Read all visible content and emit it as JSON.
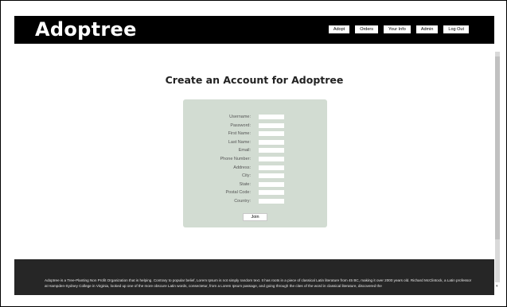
{
  "header": {
    "logo": "Adoptree",
    "nav": [
      "Adopt",
      "Orders",
      "Your Info",
      "Admin",
      "Log Out"
    ]
  },
  "main": {
    "title": "Create an Account for Adoptree",
    "form": {
      "fields": [
        {
          "label": "Username:",
          "value": ""
        },
        {
          "label": "Password:",
          "value": ""
        },
        {
          "label": "First Name:",
          "value": ""
        },
        {
          "label": "Last Name:",
          "value": ""
        },
        {
          "label": "Email:",
          "value": ""
        },
        {
          "label": "Phone Number:",
          "value": ""
        },
        {
          "label": "Address:",
          "value": ""
        },
        {
          "label": "City:",
          "value": ""
        },
        {
          "label": "State:",
          "value": ""
        },
        {
          "label": "Postal Code:",
          "value": ""
        },
        {
          "label": "Country:",
          "value": ""
        }
      ],
      "submit_label": "Join"
    }
  },
  "footer": {
    "text": "Adoptree is a Tree-Planting Non Profit Organization that is helping. Contrary to popular belief, Lorem Ipsum is not simply random text. It has roots in a piece of classical Latin literature from 45 BC, making it over 2000 years old. Richard McClintock, a Latin professor at Hampden-Sydney College in Virginia, looked up one of the more obscure Latin words, consectetur, from a Lorem Ipsum passage, and going through the cites of the word in classical literature, discovered the"
  },
  "colors": {
    "header_bg": "#000000",
    "form_bg": "#d2dcd2",
    "footer_bg": "#262626"
  }
}
